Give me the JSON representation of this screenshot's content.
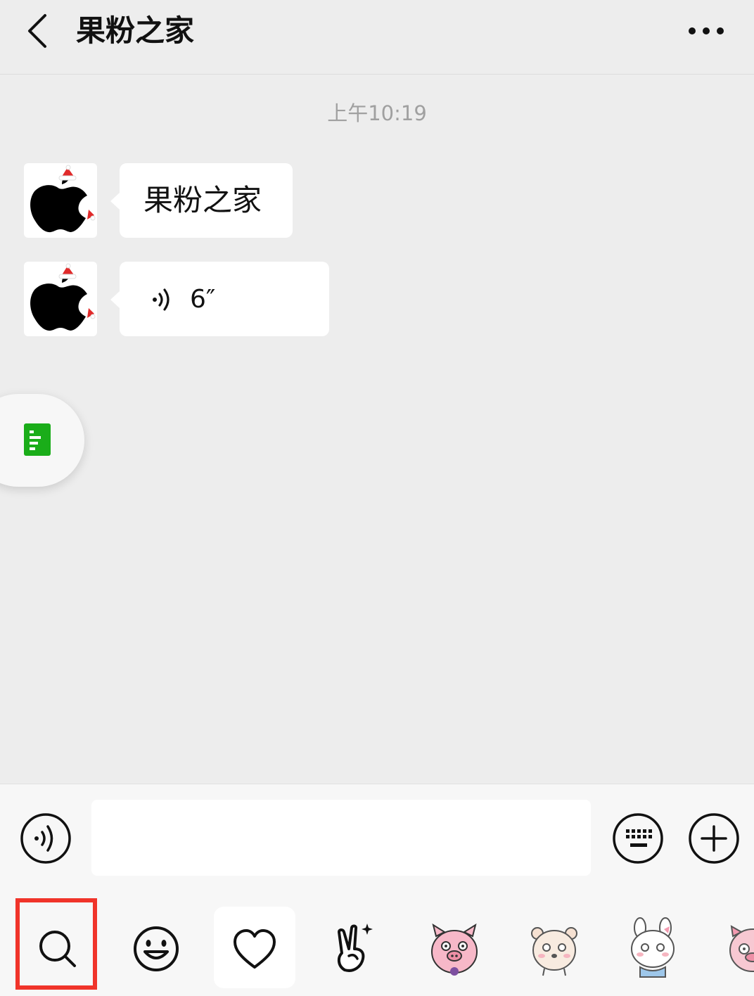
{
  "header": {
    "title": "果粉之家",
    "back_icon": "chevron-left-icon",
    "more_icon": "more-dots-icon"
  },
  "chat": {
    "timestamp": "上午10:19",
    "messages": [
      {
        "type": "text",
        "sender_avatar": "apple-logo-santa-hat",
        "text": "果粉之家"
      },
      {
        "type": "voice",
        "sender_avatar": "apple-logo-santa-hat",
        "duration": "6″"
      }
    ]
  },
  "floating": {
    "icon": "document-icon",
    "color": "#1aad19"
  },
  "input_bar": {
    "voice_button_icon": "voice-wave-icon",
    "input_value": "",
    "input_placeholder": "",
    "keyboard_button_icon": "keyboard-icon",
    "plus_button_icon": "plus-circle-icon"
  },
  "emoji_toolbar": {
    "items": [
      {
        "icon": "search-icon",
        "highlighted": true
      },
      {
        "icon": "smiley-icon"
      },
      {
        "icon": "heart-icon",
        "selected": true
      },
      {
        "icon": "victory-hand-icon"
      },
      {
        "icon": "pig-sticker-icon"
      },
      {
        "icon": "bear-sticker-icon"
      },
      {
        "icon": "bunny-sticker-icon"
      },
      {
        "icon": "pig-sticker-partial-icon"
      }
    ],
    "highlight_color": "#f0342a"
  }
}
